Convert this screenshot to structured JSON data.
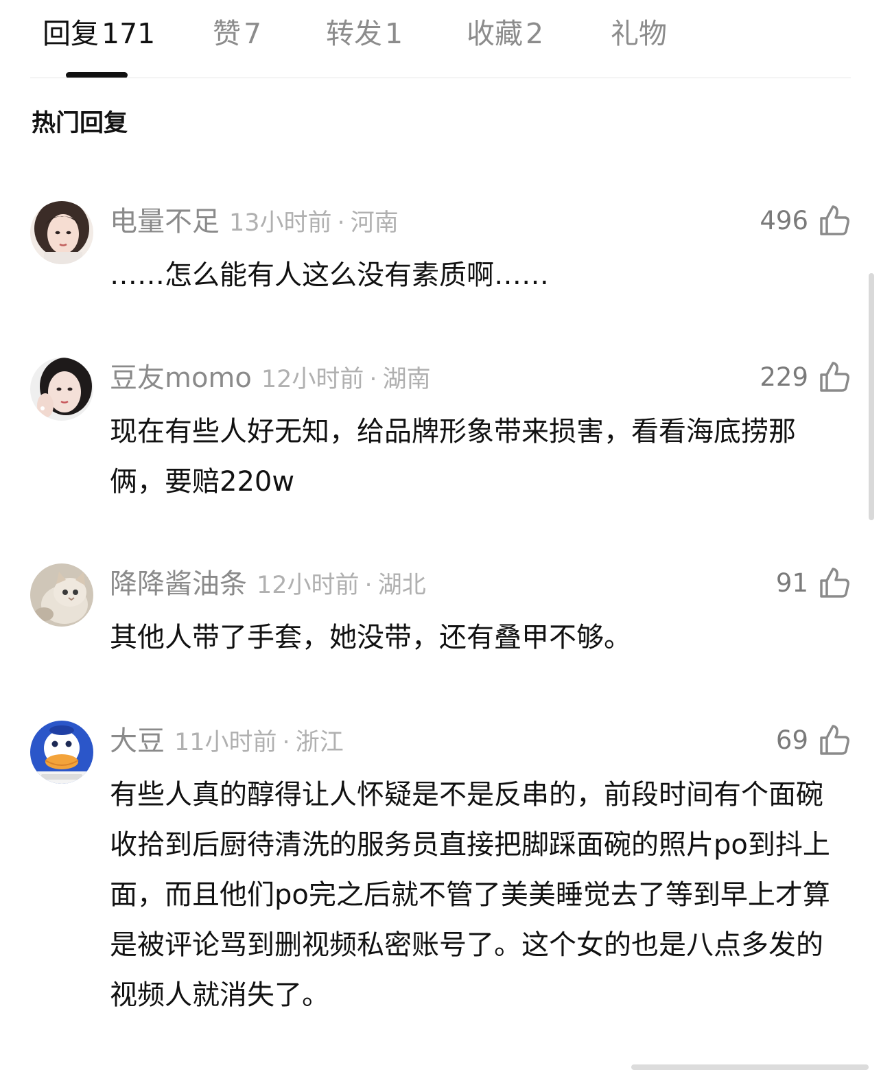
{
  "tabs": [
    {
      "label": "回复",
      "count": "171",
      "active": true
    },
    {
      "label": "赞",
      "count": "7",
      "active": false
    },
    {
      "label": "转发",
      "count": "1",
      "active": false
    },
    {
      "label": "收藏",
      "count": "2",
      "active": false
    },
    {
      "label": "礼物",
      "count": "",
      "active": false
    }
  ],
  "section_title": "热门回复",
  "comments": [
    {
      "user": "电量不足",
      "time": "13小时前",
      "separator": "·",
      "location": "河南",
      "likes": "496",
      "text": "……怎么能有人这么没有素质啊……",
      "avatar_icon": "avatar-girl-photo"
    },
    {
      "user": "豆友momo",
      "time": "12小时前",
      "separator": "·",
      "location": "湖南",
      "likes": "229",
      "text": "现在有些人好无知，给品牌形象带来损害，看看海底捞那俩，要赔220w",
      "avatar_icon": "avatar-girl-photo"
    },
    {
      "user": "降降酱油条",
      "time": "12小时前",
      "separator": "·",
      "location": "湖北",
      "likes": "91",
      "text": "其他人带了手套，她没带，还有叠甲不够。",
      "avatar_icon": "avatar-cat-photo"
    },
    {
      "user": "大豆",
      "time": "11小时前",
      "separator": "·",
      "location": "浙江",
      "likes": "69",
      "text": "有些人真的醇得让人怀疑是不是反串的，前段时间有个面碗收拾到后厨待清洗的服务员直接把脚踩面碗的照片po到抖上面，而且他们po完之后就不管了美美睡觉去了等到早上才算是被评论骂到删视频私密账号了。这个女的也是八点多发的视频人就消失了。",
      "avatar_icon": "avatar-duck-cartoon"
    }
  ],
  "colors": {
    "active_tab": "#111111",
    "inactive_tab": "#8c8c8c",
    "username": "#8a8a8a",
    "meta": "#b0b0b0",
    "like_count": "#7a7a7a"
  }
}
